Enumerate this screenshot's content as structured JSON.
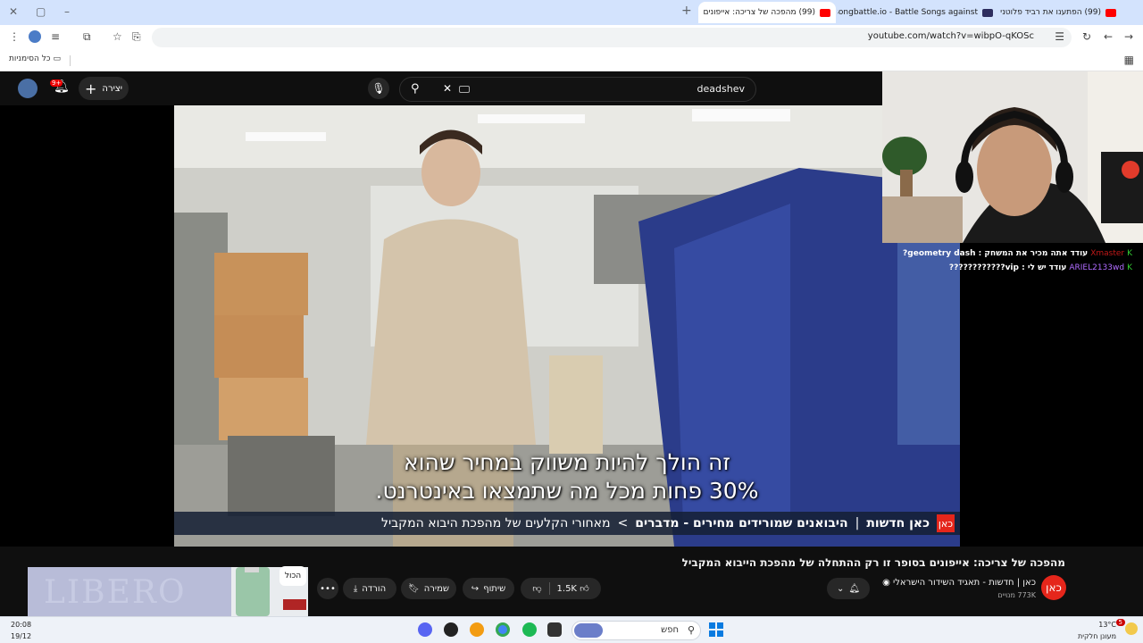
{
  "browser": {
    "tabs": [
      {
        "title": "(99) הפתענו את רביד פלוטניק"
      },
      {
        "title": "songbattle.io - Battle Songs against..."
      },
      {
        "title": "(99) מהפכה של צריכה: אייפונים"
      }
    ],
    "new_tab_label": "+",
    "url": "youtube.com/watch?v=wibpO-qKOSc",
    "bookmarks_label": "כל הסימניות"
  },
  "youtube": {
    "create_label": "יצירה",
    "notifications_badge": "9+",
    "search_query": "deadshev"
  },
  "video": {
    "subtitle_line1": "זה הולך להיות משווק במחיר שהוא",
    "subtitle_line2": "30% פחות מכל מה שתמצאו באינטרנט.",
    "ticker_channel": "כאן חדשות",
    "ticker_separator": "|",
    "ticker_topic": "היבואנים שמורידים מחירים - מדברים",
    "ticker_arrow": ">",
    "ticker_text": "מאחורי הקלעים של מהפכת היבוא המקביל",
    "ticker_logo": "כאן",
    "title": "מהפכה של צריכה: אייפונים בסופר זו רק ההתחלה של מהפכת הייבוא המקביל",
    "channel_name": "כאן | חדשות - תאגיד השידור הישראלי",
    "subscribers": "773K מנויים",
    "likes": "1.5K",
    "share_label": "שיתוף",
    "save_label": "שמירה",
    "download_label": "הורדה",
    "more_label": "•••"
  },
  "ad": {
    "brand": "LIBERO",
    "chip_all": "הכול"
  },
  "stream_chat": [
    {
      "user": "Xmaster",
      "message": "עודד אתה מכיר את המשחק : geometry dash?"
    },
    {
      "user": "ARIEL2133wd",
      "message": "עודד יש לי : vip????????????"
    }
  ],
  "taskbar": {
    "time": "20:08",
    "date": "19/12",
    "search_label": "חפש",
    "weather_temp": "13°C",
    "weather_desc": "מעונן חלקית",
    "notification_count": "5"
  }
}
